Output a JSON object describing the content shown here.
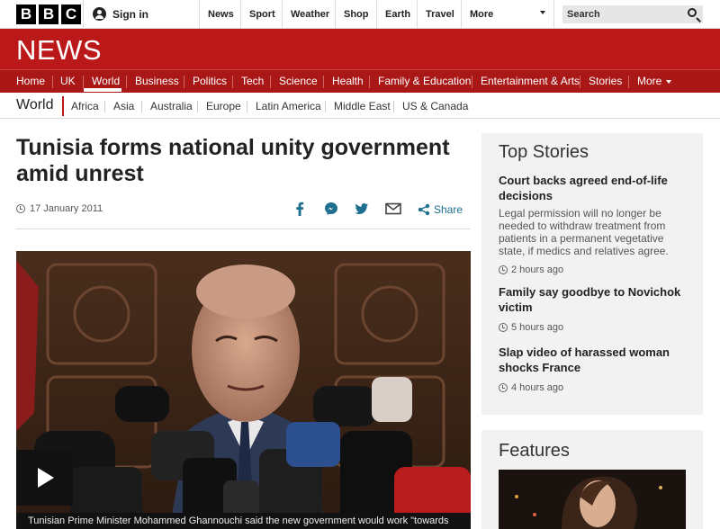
{
  "topbar": {
    "logo_letters": [
      "B",
      "B",
      "C"
    ],
    "signin_label": "Sign in",
    "nav": [
      "News",
      "Sport",
      "Weather",
      "Shop",
      "Earth",
      "Travel",
      "More"
    ],
    "search_placeholder": "Search"
  },
  "brand": {
    "news_logo": "NEWS",
    "color": "#bb1919"
  },
  "main_nav": {
    "items": [
      "Home",
      "UK",
      "World",
      "Business",
      "Politics",
      "Tech",
      "Science",
      "Health",
      "Family & Education",
      "Entertainment & Arts",
      "Stories",
      "More"
    ],
    "active": "World"
  },
  "sub_nav": {
    "section": "World",
    "items": [
      "Africa",
      "Asia",
      "Australia",
      "Europe",
      "Latin America",
      "Middle East",
      "US & Canada"
    ],
    "active": "Africa"
  },
  "article": {
    "headline": "Tunisia forms national unity government amid unrest",
    "date": "17 January 2011",
    "share_label": "Share",
    "share_icons": [
      "facebook-icon",
      "messenger-icon",
      "twitter-icon",
      "email-icon",
      "share-icon"
    ],
    "video_caption": "Tunisian Prime Minister Mohammed Ghannouchi said the new government would work \"towards"
  },
  "sidebar": {
    "top_stories_title": "Top Stories",
    "stories": [
      {
        "title": "Court backs agreed end-of-life decisions",
        "summary": "Legal permission will no longer be needed to withdraw treatment from patients in a permanent vegetative state, if medics and relatives agree.",
        "ago": "2 hours ago"
      },
      {
        "title": "Family say goodbye to Novichok victim",
        "summary": "",
        "ago": "5 hours ago"
      },
      {
        "title": "Slap video of harassed woman shocks France",
        "summary": "",
        "ago": "4 hours ago"
      }
    ],
    "features_title": "Features"
  }
}
